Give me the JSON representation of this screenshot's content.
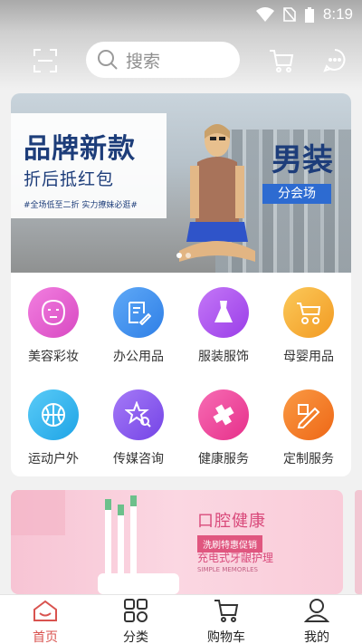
{
  "status": {
    "time": "8:19"
  },
  "header": {
    "search_placeholder": "搜索"
  },
  "banner": {
    "title": "品牌新款",
    "subtitle": "折后抵红包",
    "note": "#全场低至二折  实力撩妹必逛#",
    "right_title": "男装",
    "right_tag": "分会场"
  },
  "categories": [
    {
      "label": "美容彩妆",
      "icon": "face-mask-icon",
      "color": "#e85fd0"
    },
    {
      "label": "办公用品",
      "icon": "document-edit-icon",
      "color": "#3e8ff0"
    },
    {
      "label": "服装服饰",
      "icon": "dress-icon",
      "color": "#b356f0"
    },
    {
      "label": "母婴用品",
      "icon": "stroller-icon",
      "color": "#f6b13a"
    },
    {
      "label": "运动户外",
      "icon": "basketball-icon",
      "color": "#33b6f0"
    },
    {
      "label": "传媒咨询",
      "icon": "star-search-icon",
      "color": "#8d5cf0"
    },
    {
      "label": "健康服务",
      "icon": "health-cross-icon",
      "color": "#f0479f"
    },
    {
      "label": "定制服务",
      "icon": "pencil-ruler-icon",
      "color": "#f47a24"
    }
  ],
  "promo": {
    "title": "口腔健康",
    "badge": "洗刷特惠促销",
    "line": "充电式牙龈护理",
    "small": "SIMPLE MEMORLES"
  },
  "tabs": [
    {
      "label": "首页",
      "icon": "home-icon",
      "active": true
    },
    {
      "label": "分类",
      "icon": "grid-icon",
      "active": false
    },
    {
      "label": "购物车",
      "icon": "cart-icon",
      "active": false
    },
    {
      "label": "我的",
      "icon": "user-icon",
      "active": false
    }
  ]
}
